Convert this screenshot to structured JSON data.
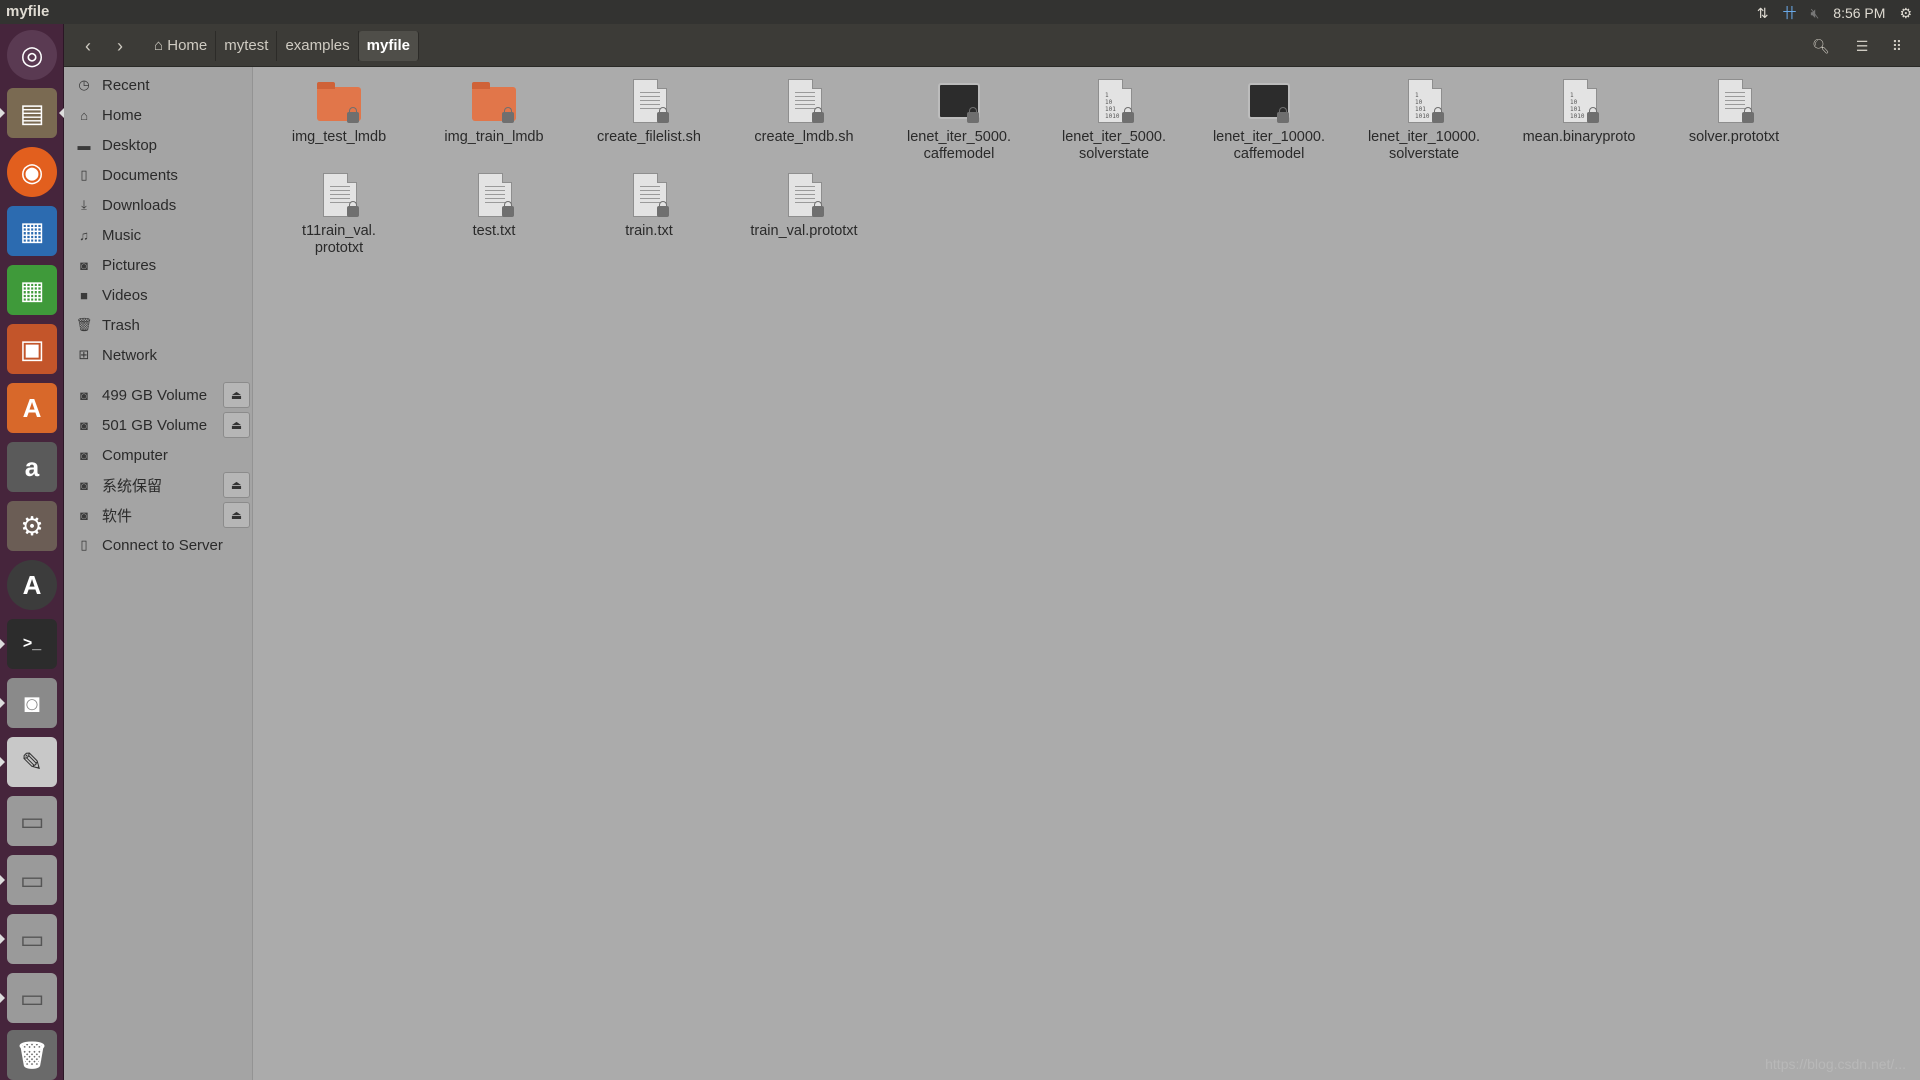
{
  "topbar": {
    "app_title": "myfile",
    "time": "8:56 PM"
  },
  "toolbar": {
    "breadcrumbs": [
      {
        "label": "Home"
      },
      {
        "label": "mytest"
      },
      {
        "label": "examples"
      },
      {
        "label": "myfile"
      }
    ]
  },
  "sidebar": {
    "places": [
      {
        "label": "Recent",
        "icon": "clock-icon"
      },
      {
        "label": "Home",
        "icon": "home-icon"
      },
      {
        "label": "Desktop",
        "icon": "folder-icon"
      },
      {
        "label": "Documents",
        "icon": "document-icon"
      },
      {
        "label": "Downloads",
        "icon": "download-icon"
      },
      {
        "label": "Music",
        "icon": "music-icon"
      },
      {
        "label": "Pictures",
        "icon": "camera-icon"
      },
      {
        "label": "Videos",
        "icon": "video-icon"
      },
      {
        "label": "Trash",
        "icon": "trash-icon"
      },
      {
        "label": "Network",
        "icon": "network-icon"
      }
    ],
    "devices": [
      {
        "label": "499 GB Volume",
        "eject": true
      },
      {
        "label": "501 GB Volume",
        "eject": true
      },
      {
        "label": "Computer",
        "eject": false
      },
      {
        "label": "系统保留",
        "eject": true
      },
      {
        "label": "软件",
        "eject": true
      },
      {
        "label": "Connect to Server",
        "eject": false
      }
    ]
  },
  "files": [
    {
      "name": "img_test_lmdb",
      "type": "folder"
    },
    {
      "name": "img_train_lmdb",
      "type": "folder"
    },
    {
      "name": "create_filelist.sh",
      "type": "script"
    },
    {
      "name": "create_lmdb.sh",
      "type": "script"
    },
    {
      "name": "lenet_iter_5000.\ncaffemodel",
      "type": "executable"
    },
    {
      "name": "lenet_iter_5000.\nsolverstate",
      "type": "binary"
    },
    {
      "name": "lenet_iter_10000.\ncaffemodel",
      "type": "executable"
    },
    {
      "name": "lenet_iter_10000.\nsolverstate",
      "type": "binary"
    },
    {
      "name": "mean.binaryproto",
      "type": "binary"
    },
    {
      "name": "solver.prototxt",
      "type": "text"
    },
    {
      "name": "t11rain_val.\nprototxt",
      "type": "text"
    },
    {
      "name": "test.txt",
      "type": "text"
    },
    {
      "name": "train.txt",
      "type": "text"
    },
    {
      "name": "train_val.prototxt",
      "type": "text"
    }
  ],
  "watermark": "https://blog.csdn.net/..."
}
